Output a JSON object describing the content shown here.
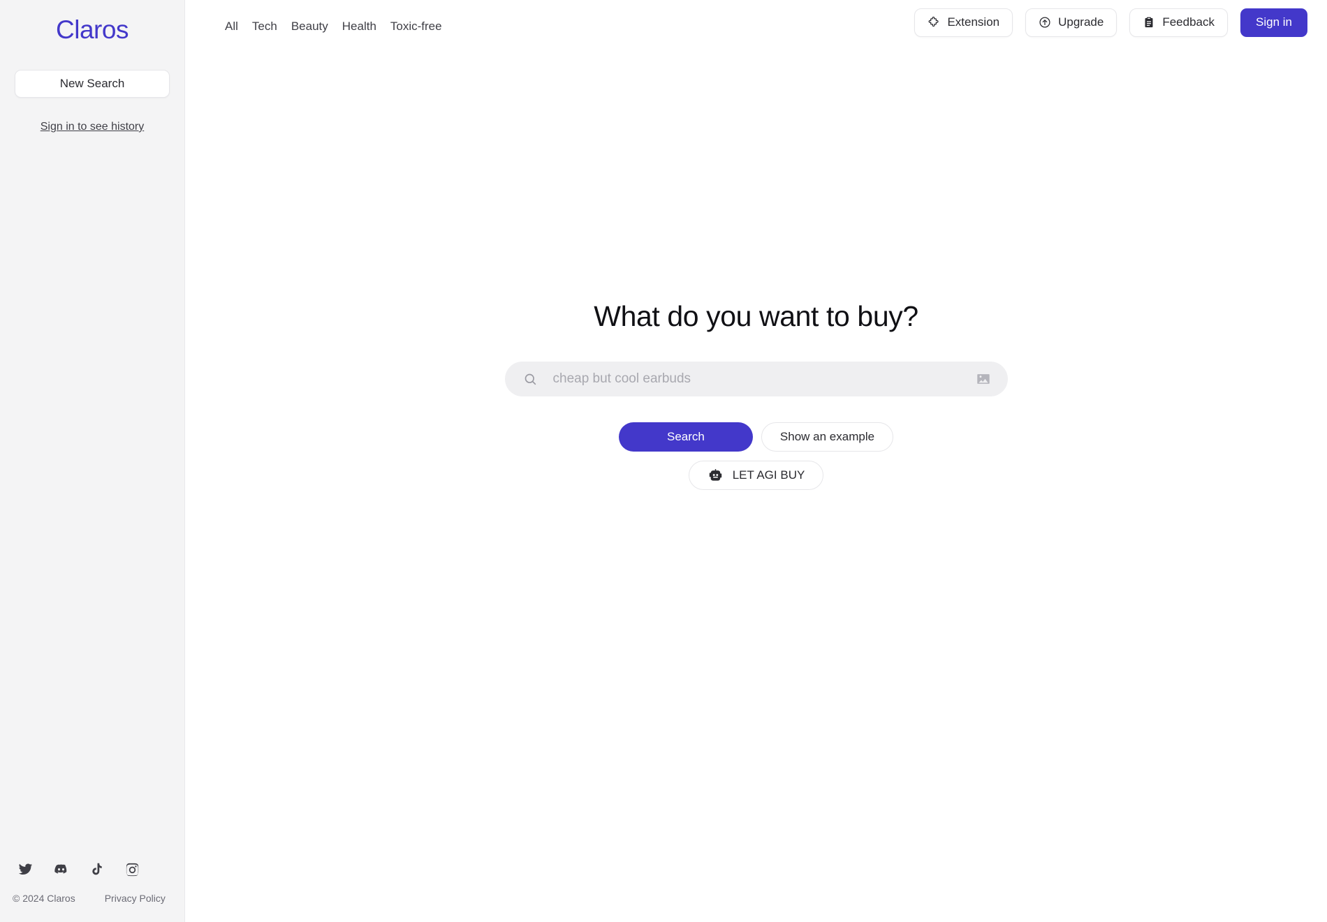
{
  "sidebar": {
    "brand": "Claros",
    "new_search_label": "New Search",
    "history_link": "Sign in to see history",
    "social": [
      {
        "name": "twitter-icon",
        "label": "Twitter"
      },
      {
        "name": "discord-icon",
        "label": "Discord"
      },
      {
        "name": "tiktok-icon",
        "label": "TikTok"
      },
      {
        "name": "instagram-icon",
        "label": "Instagram"
      }
    ],
    "copyright": "© 2024 Claros",
    "privacy": "Privacy Policy"
  },
  "topbar": {
    "tabs": [
      {
        "label": "All"
      },
      {
        "label": "Tech"
      },
      {
        "label": "Beauty"
      },
      {
        "label": "Health"
      },
      {
        "label": "Toxic-free"
      }
    ],
    "extension_label": "Extension",
    "upgrade_label": "Upgrade",
    "feedback_label": "Feedback",
    "signin_label": "Sign in"
  },
  "hero": {
    "title": "What do you want to buy?",
    "search_value": "",
    "search_placeholder": "cheap but cool earbuds",
    "search_button": "Search",
    "example_button": "Show an example",
    "agi_button": "LET AGI BUY"
  },
  "colors": {
    "accent": "#4338ca",
    "sidebar_bg": "#f4f4f5",
    "page_bg": "#ffffff",
    "search_field_bg": "#efeff1",
    "muted_text": "#6b6b75"
  }
}
